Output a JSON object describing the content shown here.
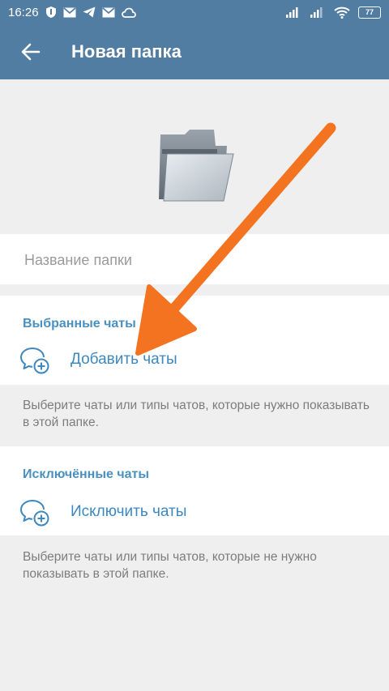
{
  "status_bar": {
    "time": "16:26",
    "battery": "77"
  },
  "app_bar": {
    "title": "Новая папка"
  },
  "folder_name": {
    "placeholder": "Название папки",
    "value": ""
  },
  "included": {
    "header": "Выбранные чаты",
    "action_label": "Добавить чаты",
    "hint": "Выберите чаты или типы чатов, которые нужно показывать в этой папке."
  },
  "excluded": {
    "header": "Исключённые чаты",
    "action_label": "Исключить чаты",
    "hint": "Выберите чаты или типы чатов, которые не нужно показывать в этой папке."
  },
  "colors": {
    "header_bg": "#517da2",
    "accent": "#4a90c0",
    "arrow": "#f47321"
  }
}
